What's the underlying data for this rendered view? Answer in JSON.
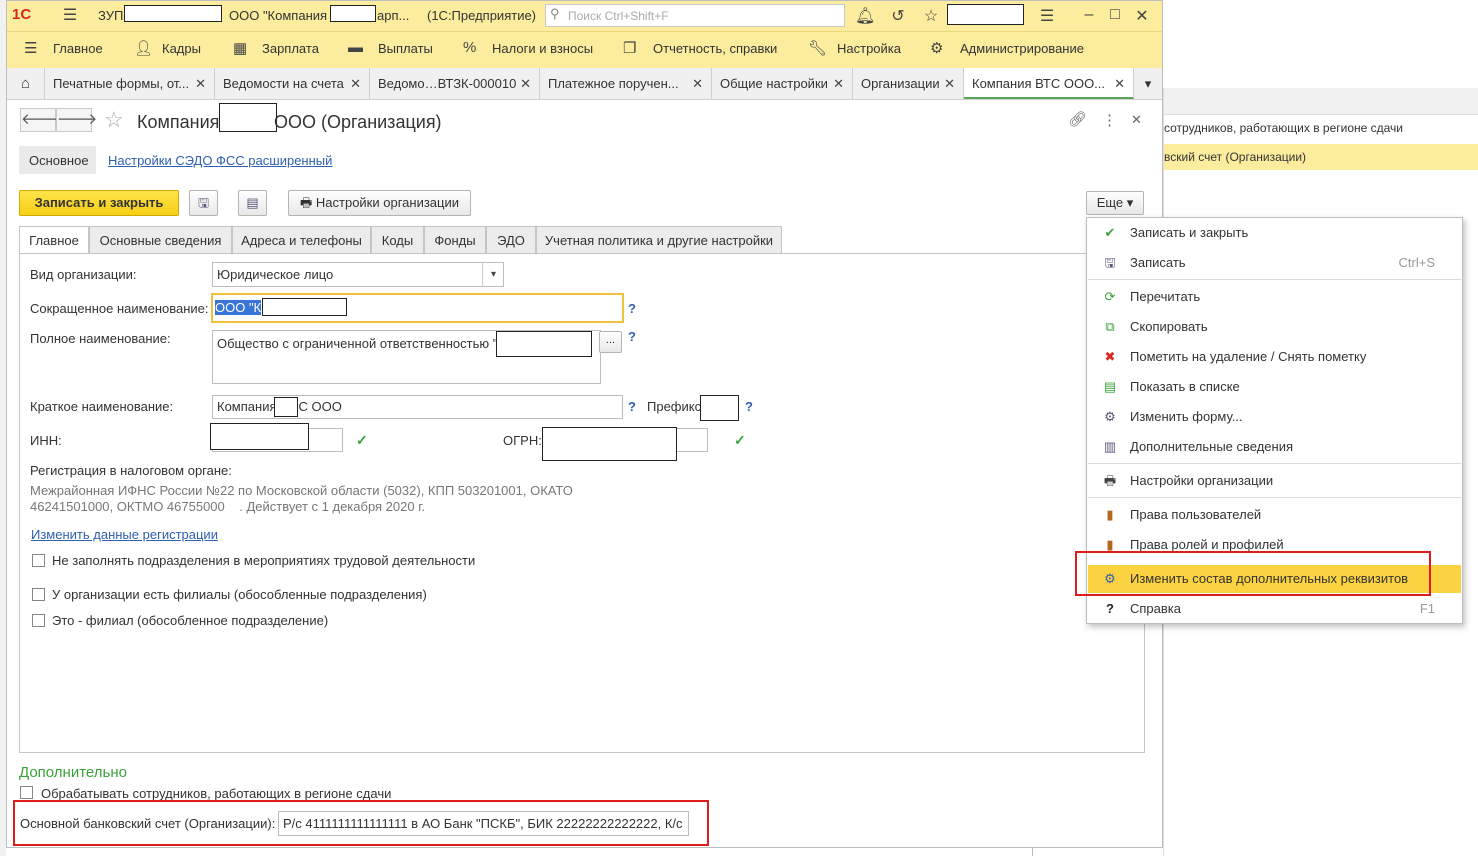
{
  "app": {
    "logo": "1С",
    "title_prefix": "ЗУП",
    "title_mid": "ООО \"Компания",
    "title_suffix": "арп...",
    "platform": "(1С:Предприятие)",
    "search_placeholder": "Поиск Ctrl+Shift+F"
  },
  "menu": [
    {
      "label": "Главное",
      "icon": "menu-icon"
    },
    {
      "label": "Кадры",
      "icon": "people-icon"
    },
    {
      "label": "Зарплата",
      "icon": "calculator-icon"
    },
    {
      "label": "Выплаты",
      "icon": "wallet-icon"
    },
    {
      "label": "Налоги и взносы",
      "icon": "percent-icon"
    },
    {
      "label": "Отчетность, справки",
      "icon": "report-icon"
    },
    {
      "label": "Настройка",
      "icon": "wrench-icon"
    },
    {
      "label": "Администрирование",
      "icon": "gear-icon"
    }
  ],
  "open_tabs": [
    "Печатные формы, от...",
    "Ведомости на счета",
    "Ведомо…ВТЗК-000010",
    "Платежное поручен...",
    "Общие настройки",
    "Организации",
    "Компания ВТС ООО..."
  ],
  "form": {
    "title_left": "Компания",
    "title_right": "ООО (Организация)",
    "nav_main": "Основное",
    "nav_link": "Настройки СЭДО ФСС расширенный",
    "save_close": "Записать и закрыть",
    "org_settings": "Настройки организации",
    "more": "Еще",
    "tabs": [
      "Главное",
      "Основные сведения",
      "Адреса и телефоны",
      "Коды",
      "Фонды",
      "ЭДО",
      "Учетная политика и другие настройки"
    ],
    "org_type_label": "Вид организации:",
    "org_type_value": "Юридическое лицо",
    "short_name_label": "Сокращенное наименование:",
    "short_name_value": "ООО \"К",
    "full_name_label": "Полное наименование:",
    "full_name_value": "Общество с ограниченной ответственностью \"",
    "brief_name_label": "Краткое наименование:",
    "brief_name_left": "Компания",
    "brief_name_right": "С ООО",
    "prefix_label": "Префикс",
    "inn_label": "ИНН:",
    "ogrn_label": "ОГРН:",
    "tax_reg_label": "Регистрация в налоговом органе:",
    "tax_reg_line1": "Межрайонная ИФНС России №22 по Московской области (5032), КПП 503201001, ОКАТО",
    "tax_reg_line2": "46241501000, ОКТМО 46755000    . Действует с 1 декабря 2020 г.",
    "change_reg_link": "Изменить данные регистрации",
    "cb1": "Не заполнять подразделения в мероприятиях трудовой деятельности",
    "cb2": "У организации есть филиалы (обособленные подразделения)",
    "cb3": "Это - филиал (обособленное подразделение)",
    "extra_title": "Дополнительно",
    "cb4": "Обрабатывать сотрудников, работающих в регионе сдачи",
    "bank_label": "Основной банковский счет (Организации):",
    "bank_value": "Р/с 4111111111111111 в АО Банк \"ПСКБ\", БИК 22222222222222, К/с"
  },
  "more_menu": [
    {
      "label": "Записать и закрыть",
      "icon": "save-close-icon",
      "shortcut": ""
    },
    {
      "label": "Записать",
      "icon": "floppy-icon",
      "shortcut": "Ctrl+S"
    },
    {
      "label": "Перечитать",
      "icon": "refresh-icon",
      "shortcut": ""
    },
    {
      "label": "Скопировать",
      "icon": "copy-icon",
      "shortcut": ""
    },
    {
      "label": "Пометить на удаление / Снять пометку",
      "icon": "delete-mark-icon",
      "shortcut": ""
    },
    {
      "label": "Показать в списке",
      "icon": "list-icon",
      "shortcut": ""
    },
    {
      "label": "Изменить форму...",
      "icon": "form-icon",
      "shortcut": ""
    },
    {
      "label": "Дополнительные сведения",
      "icon": "info-icon",
      "shortcut": ""
    },
    {
      "label": "Настройки организации",
      "icon": "printer-icon",
      "shortcut": ""
    },
    {
      "label": "Права пользователей",
      "icon": "rights-icon",
      "shortcut": ""
    },
    {
      "label": "Права ролей и профилей",
      "icon": "roles-icon",
      "shortcut": ""
    },
    {
      "label": "Изменить состав дополнительных реквизитов",
      "icon": "attributes-icon",
      "shortcut": ""
    },
    {
      "label": "Справка",
      "icon": "help-icon",
      "shortcut": "F1"
    }
  ],
  "background_list": {
    "row1": "сотрудников, работающих в регионе сдачи",
    "row2": "вский счет (Организации)"
  },
  "colors": {
    "accent": "#fbec9e",
    "highlight": "#fbd23f",
    "annotation": "#e01b1b",
    "link": "#3060b0",
    "green": "#3aa23a"
  }
}
